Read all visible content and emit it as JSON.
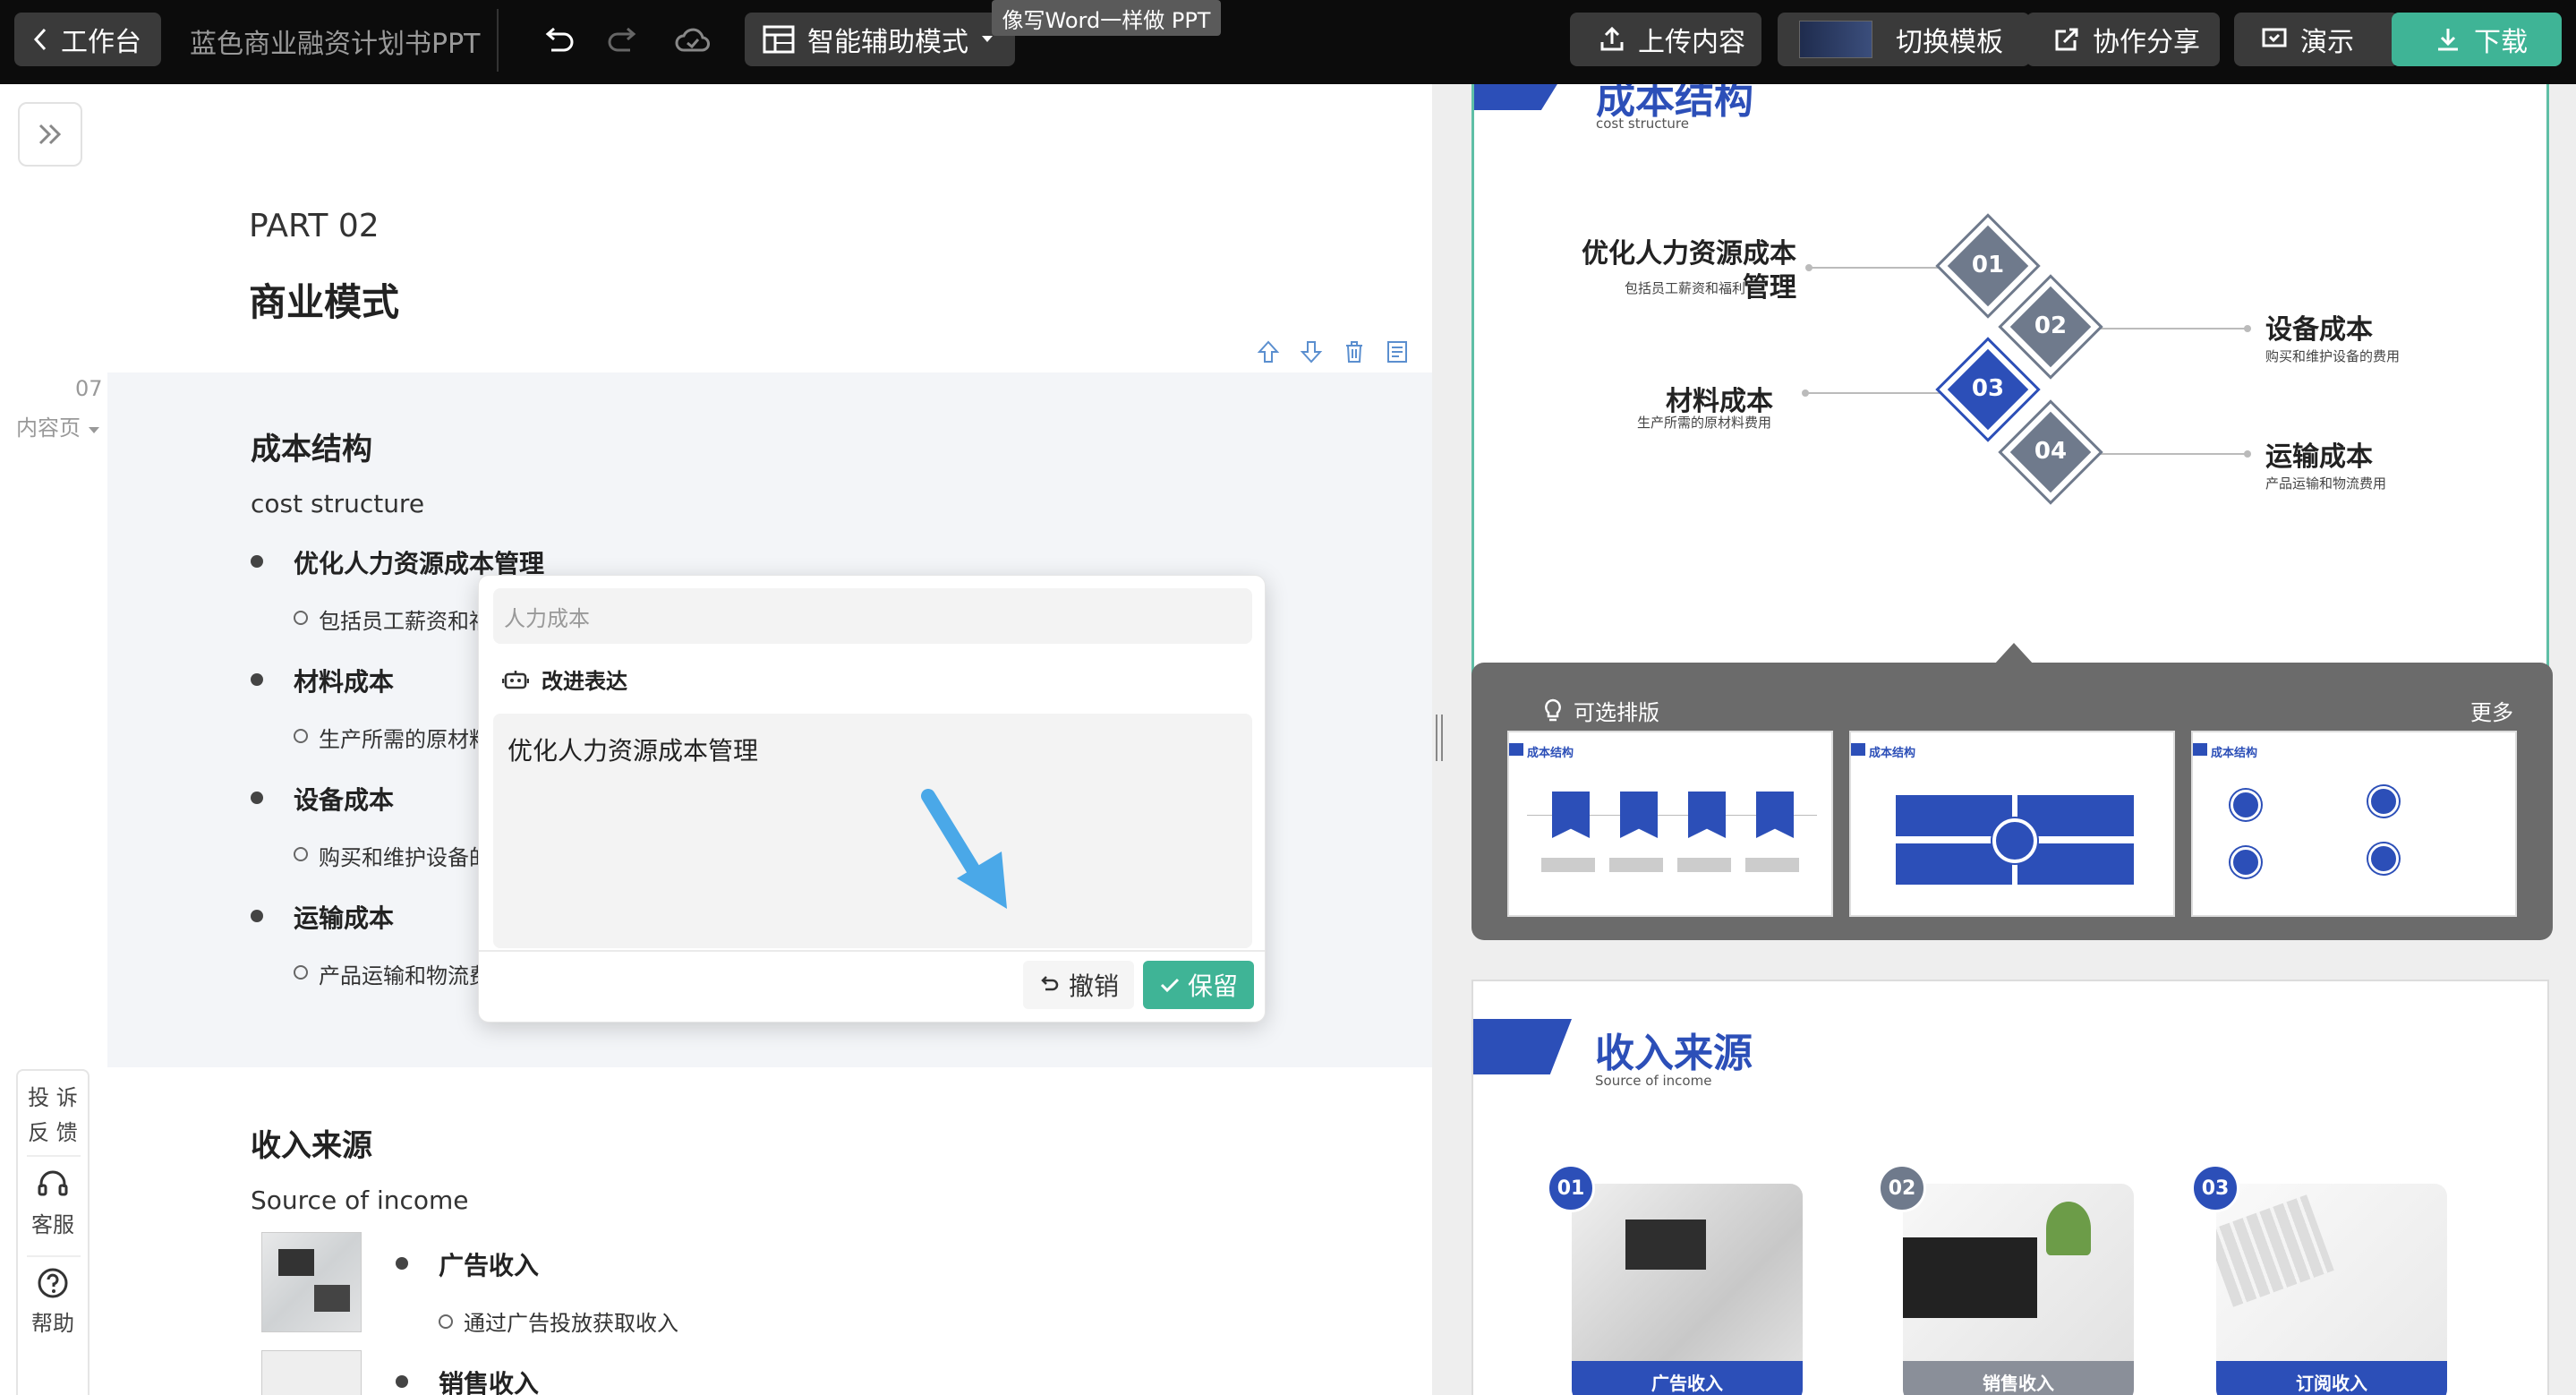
{
  "topbar": {
    "back_label": "工作台",
    "doc_title": "蓝色商业融资计划书PPT",
    "mode_label": "智能辅助模式",
    "tooltip": "像写Word一样做 PPT",
    "upload_label": "上传内容",
    "switch_template_label": "切换模板",
    "share_label": "协作分享",
    "present_label": "演示",
    "download_label": "下载"
  },
  "editor": {
    "part_label": "PART 02",
    "section_title": "商业模式",
    "page_number": "07",
    "page_type": "内容页",
    "block1": {
      "title": "成本结构",
      "subtitle": "cost structure",
      "items": [
        {
          "label": "优化人力资源成本管理",
          "sub": "包括员工薪资和福利"
        },
        {
          "label": "材料成本",
          "sub": "生产所需的原材料费用"
        },
        {
          "label": "设备成本",
          "sub": "购买和维护设备的费用"
        },
        {
          "label": "运输成本",
          "sub": "产品运输和物流费用"
        }
      ]
    },
    "block2": {
      "title": "收入来源",
      "subtitle": "Source of income",
      "items": [
        {
          "label": "广告收入",
          "sub": "通过广告投放获取收入"
        },
        {
          "label": "销售收入",
          "sub": ""
        }
      ]
    }
  },
  "popup": {
    "input_value": "人力成本",
    "improve_label": "改进表达",
    "result_text": "优化人力资源成本管理",
    "undo_label": "撤销",
    "keep_label": "保留"
  },
  "help": {
    "feedback_label_1": "投 诉",
    "feedback_label_2": "反 馈",
    "support_label": "客服",
    "help_label": "帮助"
  },
  "preview": {
    "slide1": {
      "title": "成本结构",
      "subtitle": "cost structure",
      "items": [
        {
          "num": "01",
          "label": "优化人力资源成本管理",
          "desc": "包括员工薪资和福利"
        },
        {
          "num": "02",
          "label": "设备成本",
          "desc": "购买和维护设备的费用"
        },
        {
          "num": "03",
          "label": "材料成本",
          "desc": "生产所需的原材料费用"
        },
        {
          "num": "04",
          "label": "运输成本",
          "desc": "产品运输和物流费用"
        }
      ]
    },
    "layouts": {
      "title": "可选排版",
      "more_label": "更多",
      "thumb_title": "成本结构"
    },
    "slide2": {
      "title": "收入来源",
      "subtitle": "Source of income",
      "cards": [
        {
          "num": "01",
          "label": "广告收入"
        },
        {
          "num": "02",
          "label": "销售收入"
        },
        {
          "num": "03",
          "label": "订阅收入"
        }
      ]
    }
  },
  "colors": {
    "accent_green": "#3fb496",
    "brand_blue": "#2c4fb8",
    "slate_diamond": "#6f7a8c"
  }
}
